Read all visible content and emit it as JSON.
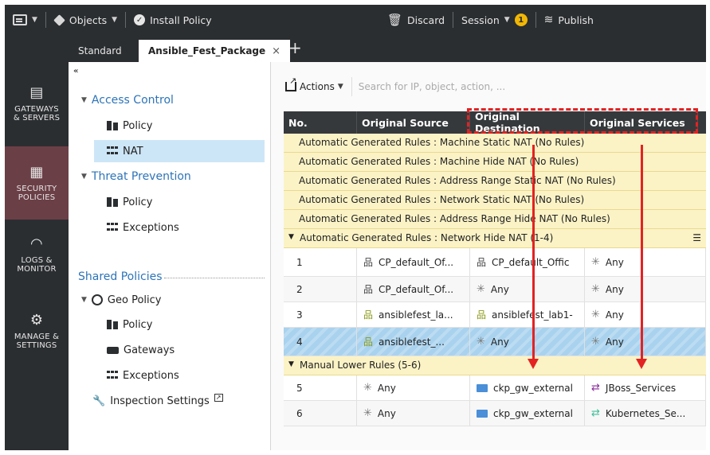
{
  "topbar": {
    "objects_label": "Objects",
    "install_label": "Install Policy",
    "discard_label": "Discard",
    "session_label": "Session",
    "session_count": "1",
    "publish_label": "Publish"
  },
  "tabs": [
    {
      "label": "Standard"
    },
    {
      "label": "Ansible_Fest_Package",
      "close": "×"
    }
  ],
  "tab_add": "+",
  "nav": [
    {
      "label": "GATEWAYS\n& SERVERS"
    },
    {
      "label": "SECURITY\nPOLICIES"
    },
    {
      "label": "LOGS &\nMONITOR"
    },
    {
      "label": "MANAGE &\nSETTINGS"
    }
  ],
  "tree": {
    "collapse": "«",
    "access_control": "Access Control",
    "ac_policy": "Policy",
    "ac_nat": "NAT",
    "threat_prevention": "Threat Prevention",
    "tp_policy": "Policy",
    "tp_exceptions": "Exceptions",
    "shared_policies": "Shared Policies",
    "geo_policy": "Geo Policy",
    "geo_policy_item": "Policy",
    "gateways": "Gateways",
    "exceptions": "Exceptions",
    "inspection_settings": "Inspection Settings"
  },
  "toolbar": {
    "actions_label": "Actions",
    "search_placeholder": "Search for IP, object, action, ..."
  },
  "table": {
    "headers": [
      "No.",
      "Original Source",
      "Original Destination",
      "Original Services"
    ],
    "groups": [
      "Automatic Generated Rules : Machine Static NAT (No Rules)",
      "Automatic Generated Rules : Machine Hide NAT (No Rules)",
      "Automatic Generated Rules : Address Range Static NAT (No Rules)",
      "Automatic Generated Rules : Network Static NAT (No Rules)",
      "Automatic Generated Rules : Address Range Hide NAT (No Rules)"
    ],
    "section1": "Automatic Generated Rules : Network Hide NAT (1-4)",
    "section1_menu": "☰",
    "rows1": [
      {
        "no": "1",
        "src": "CP_default_Of...",
        "dst": "CP_default_Offic",
        "svc": "Any"
      },
      {
        "no": "2",
        "src": "CP_default_Of...",
        "dst": "Any",
        "svc": "Any"
      },
      {
        "no": "3",
        "src": "ansiblefest_la...",
        "dst": "ansiblefest_lab1-",
        "svc": "Any"
      },
      {
        "no": "4",
        "src": "ansiblefest_...",
        "dst": "Any",
        "svc": "Any"
      }
    ],
    "section2": "Manual Lower Rules (5-6)",
    "rows2": [
      {
        "no": "5",
        "src": "Any",
        "dst": "ckp_gw_external",
        "svc": "JBoss_Services"
      },
      {
        "no": "6",
        "src": "Any",
        "dst": "ckp_gw_external",
        "svc": "Kubernetes_Se..."
      }
    ]
  },
  "colors": {
    "dark_bar": "#2b2e31",
    "active_nav": "#6b3f46",
    "section_blue": "#2d74b8",
    "group_yellow": "#fbf3c6",
    "highlight_red": "#e32222",
    "selected_blue": "#a9d2ee"
  }
}
